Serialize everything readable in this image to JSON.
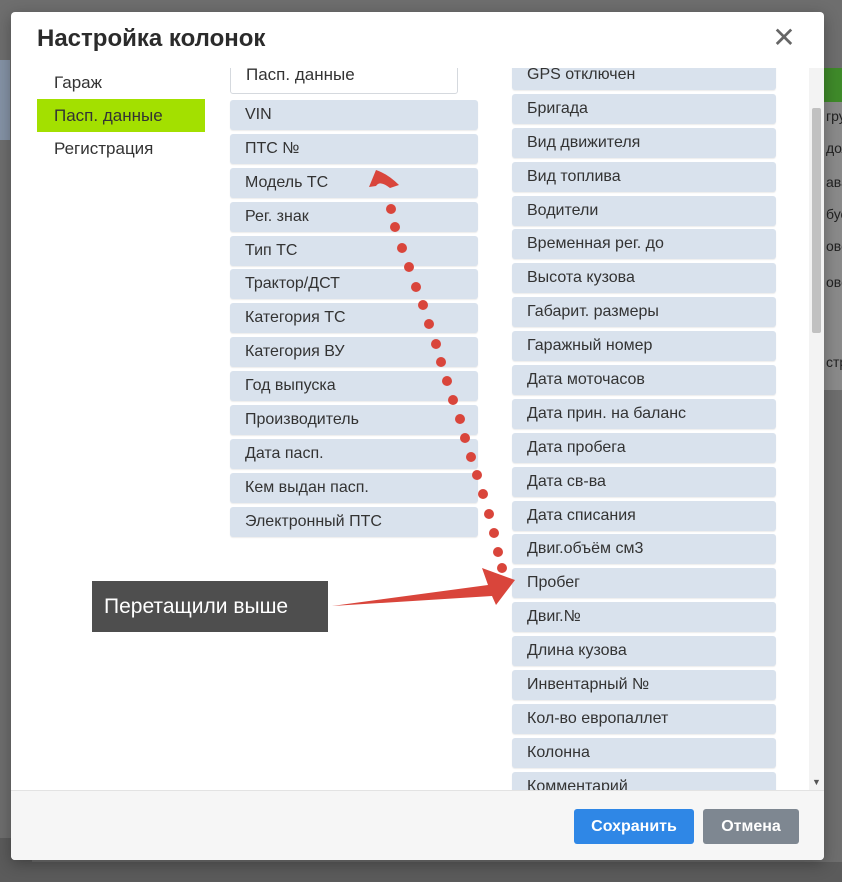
{
  "background": {
    "rows": [
      "гру",
      "дол",
      "ава",
      "бус",
      "ово",
      "ово",
      "стр"
    ]
  },
  "modal": {
    "title": "Настройка колонок",
    "close_glyph": "✕"
  },
  "left_menu": {
    "items": [
      {
        "label": "Гараж"
      },
      {
        "label": "Пасп. данные",
        "active": true
      },
      {
        "label": "Регистрация"
      }
    ]
  },
  "mid_column": {
    "header_value": "Пасп. данные",
    "items": [
      "VIN",
      "ПТС №",
      "Модель ТС",
      "Рег. знак",
      "Тип ТС",
      "Трактор/ДСТ",
      "Категория ТС",
      "Категория ВУ",
      "Год выпуска",
      "Производитель",
      "Дата пасп.",
      "Кем выдан пасп.",
      "Электронный ПТС"
    ]
  },
  "right_column": {
    "items": [
      "GPS отключен",
      "Бригада",
      "Вид движителя",
      "Вид топлива",
      "Водители",
      "Временная рег. до",
      "Высота кузова",
      "Габарит. размеры",
      "Гаражный номер",
      "Дата моточасов",
      "Дата прин. на баланс",
      "Дата пробега",
      "Дата св-ва",
      "Дата списания",
      "Двиг.объём см3",
      "Пробег",
      "Двиг.№",
      "Длина кузова",
      "Инвентарный №",
      "Кол-во европаллет",
      "Колонна",
      "Комментарий"
    ]
  },
  "footer": {
    "save_label": "Сохранить",
    "cancel_label": "Отмена"
  },
  "annotation": {
    "callout_text": "Перетащили выше",
    "color": "#d9453b"
  },
  "colors": {
    "accent_active": "#a3e000",
    "chip_bg": "#d9e2ed",
    "save_bg": "#2f87e6",
    "cancel_bg": "#7e8791"
  }
}
